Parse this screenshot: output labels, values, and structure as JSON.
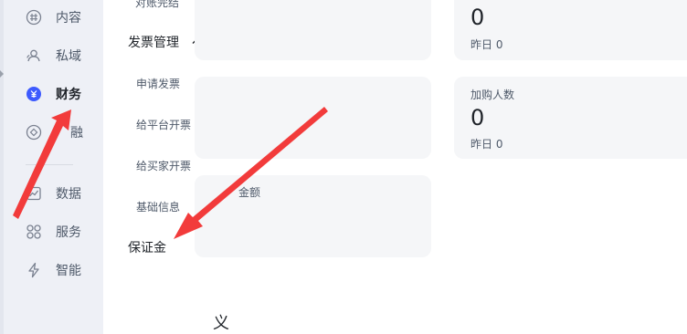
{
  "sidebar": {
    "items": [
      {
        "label": "内容",
        "icon": "hash-circle-icon"
      },
      {
        "label": "私域",
        "icon": "users-icon"
      },
      {
        "label": "财务",
        "icon": "yuan-circle-icon",
        "active": true
      },
      {
        "label": "融",
        "icon": "diamond-circle-icon"
      },
      {
        "label": "数据",
        "icon": "line-chart-icon"
      },
      {
        "label": "服务",
        "icon": "grid-four-icon"
      },
      {
        "label": "智能",
        "icon": "lightning-icon"
      }
    ]
  },
  "submenu": {
    "cut_item": "对账完结",
    "section_title": "发票管理",
    "items": [
      "申请发票",
      "给平台开票",
      "给买家开票",
      "基础信息"
    ],
    "bottom_item": "保证金"
  },
  "cards": {
    "top_right": {
      "value": "0",
      "sub": "昨日 0"
    },
    "mid_right": {
      "title": "加购人数",
      "value": "0",
      "sub": "昨日 0"
    },
    "mid_left_title": "金额"
  },
  "main": {
    "bottom_char": "义"
  },
  "colors": {
    "accent": "#3d5afe",
    "arrow": "#f23b3b"
  }
}
